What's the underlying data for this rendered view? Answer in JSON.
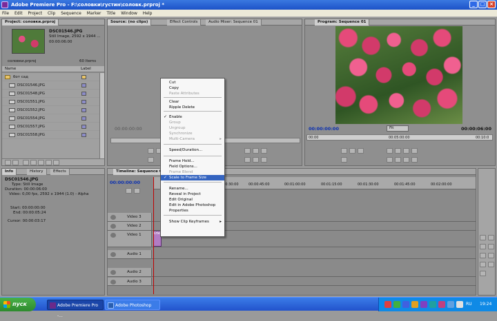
{
  "window": {
    "title": "Adobe Premiere Pro - F:\\соловки\\густин\\соловк.prproj *",
    "buttons": [
      "_",
      "□",
      "×"
    ]
  },
  "menu": [
    "File",
    "Edit",
    "Project",
    "Clip",
    "Sequence",
    "Marker",
    "Title",
    "Window",
    "Help"
  ],
  "project_panel": {
    "tab": "Project: соловки.prproj",
    "clip_name": "DSC01546.JPG",
    "clip_info1": "Still Image, 2592 x 1944 ...",
    "clip_info2": "00:00:06:00",
    "project_file": "соловки.prproj",
    "items_count": "60 Items",
    "col_name": "Name",
    "col_label": "Label",
    "folder": "бот сад",
    "files": [
      "DSC01546.JPG",
      "DSC01548.JPG",
      "DSC01551.JPG",
      "DSC01552.JPG",
      "DSC01554.JPG",
      "DSC01557.JPG",
      "DSC01558.JPG"
    ]
  },
  "source_panel": {
    "tabs": [
      "Source: (no clips)",
      "Effect Controls",
      "Audio Mixer: Sequence 01"
    ],
    "timecode": "00:00:00:00"
  },
  "program_panel": {
    "tab": "Program: Sequence 01",
    "timecode_left": "00:00:00:00",
    "fit": "Fit",
    "timecode_right": "00:00:06:00",
    "ruler": [
      "00:00",
      "00:05:00:00",
      "00:10:0"
    ]
  },
  "info_panel": {
    "tabs": [
      "Info",
      "History",
      "Effects"
    ],
    "name": "DSC01546.JPG",
    "type": "Type: Still Image",
    "duration": "Duration: 00:00:06:00",
    "video": "Video: 0,00 fps, 2592 x 1944 (1.0) - Alpha",
    "start": "Start: 00:00:00:00",
    "end": "End: 00:00:05:24",
    "cursor": "Cursor: 00:00:03:17"
  },
  "timeline": {
    "tab": "Timeline: Sequence 0",
    "timecode": "00:00:00:00",
    "ruler": [
      "00:00:30:00",
      "00:00:45:00",
      "00:01:00:00",
      "00:01:15:00",
      "00:01:30:00",
      "00:01:45:00",
      "00:02:00:00"
    ],
    "tracks": [
      "Video 3",
      "Video 2",
      "Video 1",
      "Audio 1",
      "Audio 2",
      "Audio 3"
    ],
    "clip_label": "DSC"
  },
  "context_menu": {
    "items": [
      {
        "label": "Cut",
        "enabled": true
      },
      {
        "label": "Copy",
        "enabled": true
      },
      {
        "label": "Paste Attributes",
        "enabled": false
      },
      {
        "label": "Clear",
        "enabled": true
      },
      {
        "label": "Ripple Delete",
        "enabled": true
      },
      {
        "label": "Enable",
        "enabled": true,
        "checked": true
      },
      {
        "label": "Group",
        "enabled": false
      },
      {
        "label": "Ungroup",
        "enabled": false
      },
      {
        "label": "Synchronize",
        "enabled": false
      },
      {
        "label": "Multi-Camera",
        "enabled": false
      },
      {
        "label": "Speed/Duration...",
        "enabled": true
      },
      {
        "label": "Frame Hold...",
        "enabled": true
      },
      {
        "label": "Field Options...",
        "enabled": true
      },
      {
        "label": "Frame Blend",
        "enabled": false
      },
      {
        "label": "Scale to Frame Size",
        "enabled": true,
        "checked": true,
        "highlighted": true
      },
      {
        "label": "Rename...",
        "enabled": true
      },
      {
        "label": "Reveal in Project",
        "enabled": true
      },
      {
        "label": "Edit Original",
        "enabled": true
      },
      {
        "label": "Edit in Adobe Photoshop",
        "enabled": true
      },
      {
        "label": "Properties",
        "enabled": true
      },
      {
        "label": "Show Clip Keyframes",
        "enabled": true
      }
    ]
  },
  "taskbar": {
    "start": "пуск",
    "tasks": [
      "Adobe Premiere Pro -...",
      "Adobe Photoshop"
    ],
    "lang": "RU",
    "clock": "19:24"
  },
  "colors": {
    "title_bar": "#1c52c8",
    "menu_highlight": "#3464c0",
    "timecode_blue": "#0a2fb0",
    "flowers": "#d23a6a"
  }
}
